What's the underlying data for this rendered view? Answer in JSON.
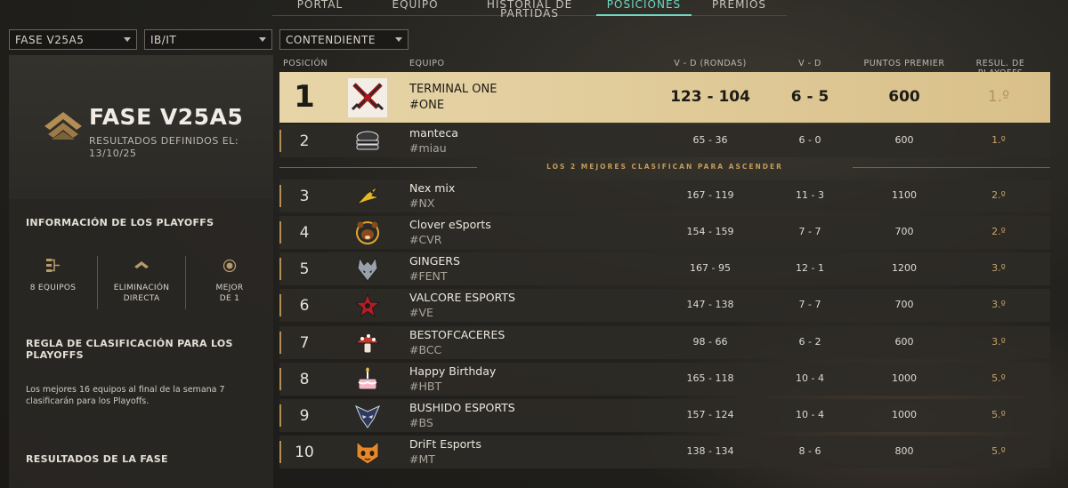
{
  "tabs": [
    "PORTAL",
    "EQUIPO",
    "HISTORIAL DE PARTIDAS",
    "POSICIONES",
    "PREMIOS"
  ],
  "filters": {
    "phase": "FASE V25A5",
    "region": "IB/IT",
    "division": "CONTENDIENTE"
  },
  "phase_card": {
    "title": "FASE V25A5",
    "subtitle": "RESULTADOS DEFINIDOS EL:",
    "date": "13/10/25"
  },
  "playoffs": {
    "title": "INFORMACIÓN DE LOS PLAYOFFS",
    "stats": [
      {
        "icon": "bracket-icon",
        "label_line1": "8 EQUIPOS",
        "label_line2": ""
      },
      {
        "icon": "chevron-rank-icon",
        "label_line1": "ELIMINACIÓN",
        "label_line2": "DIRECTA"
      },
      {
        "icon": "target-circle-icon",
        "label_line1": "MEJOR",
        "label_line2": "DE 1"
      }
    ],
    "rule_title": "REGLA DE CLASIFICACIÓN PARA LOS PLAYOFFS",
    "rule_text": "Los mejores 16 equipos al final de la semana 7 clasificarán para los Playoffs.",
    "results_title": "RESULTADOS DE LA FASE"
  },
  "table": {
    "headers": {
      "position": "POSICIÓN",
      "team": "EQUIPO",
      "vd_rounds": "V - D (RONDAS)",
      "vd": "V - D",
      "points": "PUNTOS PREMIER",
      "result": "RESUL. DE PLAYOFFS"
    },
    "promotion_note": "LOS 2 MEJORES CLASIFICAN PARA ASCENDER",
    "rows": [
      {
        "pos": "1",
        "name": "TERMINAL ONE",
        "tag": "#ONE",
        "vd_rounds": "123 - 104",
        "vd": "6 - 5",
        "points": "600",
        "result": "1.º",
        "logo": "crossed-swords-logo"
      },
      {
        "pos": "2",
        "name": "manteca",
        "tag": "#miau",
        "vd_rounds": "65 - 36",
        "vd": "6 - 0",
        "points": "600",
        "result": "1.º",
        "logo": "burger-logo"
      },
      {
        "pos": "3",
        "name": "Nex mix",
        "tag": "#NX",
        "vd_rounds": "167 - 119",
        "vd": "11 - 3",
        "points": "1100",
        "result": "2.º",
        "logo": "yellow-bird-logo"
      },
      {
        "pos": "4",
        "name": "Clover eSports",
        "tag": "#CVR",
        "vd_rounds": "154 - 159",
        "vd": "7 - 7",
        "points": "700",
        "result": "2.º",
        "logo": "bear-logo"
      },
      {
        "pos": "5",
        "name": "GINGERS",
        "tag": "#FENT",
        "vd_rounds": "167 - 95",
        "vd": "12 - 1",
        "points": "1200",
        "result": "3.º",
        "logo": "wolf-logo"
      },
      {
        "pos": "6",
        "name": "VALCORE ESPORTS",
        "tag": "#VE",
        "vd_rounds": "147 - 138",
        "vd": "7 - 7",
        "points": "700",
        "result": "3.º",
        "logo": "red-star-logo"
      },
      {
        "pos": "7",
        "name": "BESTOFCACERES",
        "tag": "#BCC",
        "vd_rounds": "98 - 66",
        "vd": "6 - 2",
        "points": "600",
        "result": "3.º",
        "logo": "mushroom-logo"
      },
      {
        "pos": "8",
        "name": "Happy Birthday",
        "tag": "#HBT",
        "vd_rounds": "165 - 118",
        "vd": "10 - 4",
        "points": "1000",
        "result": "5.º",
        "logo": "cake-logo"
      },
      {
        "pos": "9",
        "name": "BUSHIDO ESPORTS",
        "tag": "#BS",
        "vd_rounds": "157 - 124",
        "vd": "10 - 4",
        "points": "1000",
        "result": "5.º",
        "logo": "samurai-logo"
      },
      {
        "pos": "10",
        "name": "DriFt Esports",
        "tag": "#MT",
        "vd_rounds": "138 - 134",
        "vd": "8 - 6",
        "points": "800",
        "result": "5.º",
        "logo": "orange-cat-logo"
      }
    ]
  },
  "colors": {
    "accent_teal": "#6fd7c2",
    "gold": "#c9a36a",
    "first_row_bg": "#e7d5a8"
  }
}
